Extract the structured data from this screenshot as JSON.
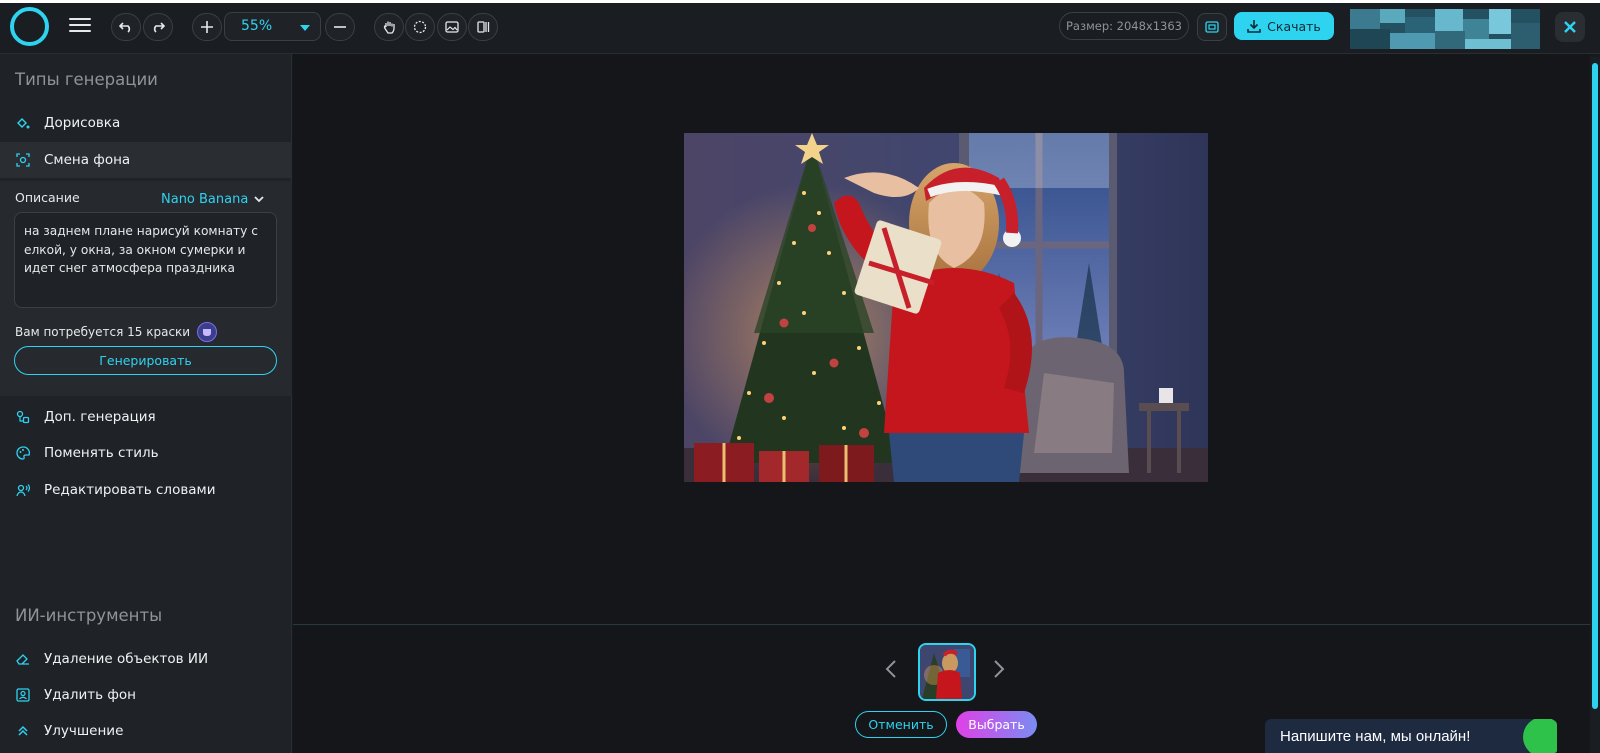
{
  "toolbar": {
    "zoom_value": "55%",
    "size_text": "Размер: 2048x1363",
    "download_label": "Скачать"
  },
  "sidebar": {
    "section_generation_title": "Типы генерации",
    "items": [
      {
        "label": "Дорисовка",
        "icon": "paint-bucket-icon"
      },
      {
        "label": "Смена фона",
        "icon": "background-swap-icon",
        "active": true
      },
      {
        "label": "Доп. генерация",
        "icon": "extra-generation-icon"
      },
      {
        "label": "Поменять стиль",
        "icon": "palette-icon"
      },
      {
        "label": "Редактировать словами",
        "icon": "voice-edit-icon"
      }
    ],
    "panel": {
      "description_label": "Описание",
      "model_name": "Nano Banana",
      "prompt_text": "на заднем плане нарисуй комнату с елкой, у окна, за окном сумерки и идет снег атмосфера праздника",
      "cost_text": "Вам потребуется 15 краски",
      "generate_label": "Генерировать"
    },
    "section_ai_title": "ИИ-инструменты",
    "ai_items": [
      {
        "label": "Удаление объектов ИИ",
        "icon": "eraser-icon"
      },
      {
        "label": "Удалить фон",
        "icon": "remove-background-icon"
      },
      {
        "label": "Улучшение",
        "icon": "enhance-icon"
      }
    ]
  },
  "bottom": {
    "cancel_label": "Отменить",
    "select_label": "Выбрать"
  },
  "chat": {
    "text": "Напишите нам, мы онлайн!"
  },
  "colors": {
    "accent": "#2ed3f0",
    "background": "#16191d",
    "sidebar": "#1f2226",
    "select_gradient_start": "#e040e8",
    "select_gradient_end": "#7a8cf2"
  }
}
